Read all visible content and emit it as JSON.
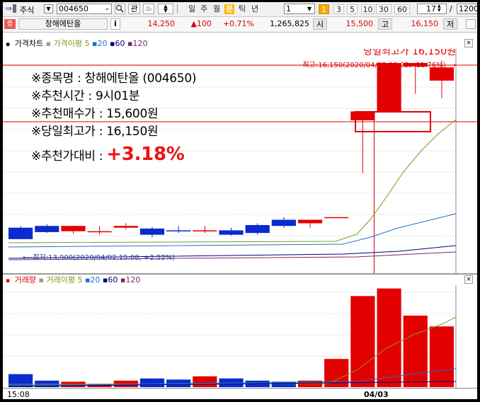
{
  "toolbar": {
    "market_label": "주식",
    "stock_code": "004650",
    "search_icon": "magnifier-icon",
    "interest_label": "관",
    "period_tabs": [
      {
        "label": "일",
        "active": false
      },
      {
        "label": "주",
        "active": false
      },
      {
        "label": "월",
        "active": false
      },
      {
        "label": "분",
        "active": true
      },
      {
        "label": "틱",
        "active": false
      },
      {
        "label": "년",
        "active": false
      }
    ],
    "unit_value": "1",
    "interval_buttons": [
      {
        "label": "1",
        "active": true
      },
      {
        "label": "3",
        "active": false
      },
      {
        "label": "5",
        "active": false
      },
      {
        "label": "10",
        "active": false
      },
      {
        "label": "30",
        "active": false
      },
      {
        "label": "60",
        "active": false
      }
    ],
    "zoom_value": "17",
    "divider": "/",
    "total_value": "1200"
  },
  "quote_bar": {
    "badge": "증",
    "stock_name": "창해에탄올",
    "info_label": "i",
    "price": "14,250",
    "change": "▲100",
    "change_pct": "+0.71%",
    "volume": "1,265,825",
    "open_label": "시",
    "open_value": "15,500",
    "high_label": "고",
    "high_value": "16,150",
    "low_label": "저"
  },
  "price_panel": {
    "legend_title": "가격차트",
    "legend_ma_label": "가격이평",
    "legend_periods": [
      "5",
      "20",
      "60",
      "120"
    ],
    "legend_colors": [
      "#7a9a1a",
      "#1f6fd0",
      "#000080",
      "#7a2a6a"
    ],
    "annotation_title": "당일최고가 16,150원",
    "high_marker": "최고:16,150(2020/04/03,09:03, -11.76%)⟶",
    "low_marker": "⟵최저:13,900(2020/04/02,15:08, +2.52%)",
    "recommendation": {
      "name_line": "※종목명 : 창해에탄올 (004650)",
      "time_line": "※추천시간 : 9시01분",
      "buy_line": "※추천매수가 : 15,600원",
      "high_line": "※당일최고가 : 16,150원",
      "ratio_label": "※추천가대비 :",
      "ratio_value": "+3.18%"
    }
  },
  "volume_panel": {
    "legend_title": "거래량",
    "legend_ma_label": "거래이평",
    "legend_periods": [
      "5",
      "20",
      "60",
      "120"
    ]
  },
  "x_axis": {
    "labels": [
      "15:08",
      "04/03"
    ]
  },
  "chart_data": {
    "type": "candlestick",
    "candles": [
      {
        "open": 14280,
        "high": 14300,
        "low": 14150,
        "close": 14150,
        "volume": 60
      },
      {
        "open": 14300,
        "high": 14320,
        "low": 14220,
        "close": 14230,
        "volume": 30
      },
      {
        "open": 14240,
        "high": 14300,
        "low": 14210,
        "close": 14300,
        "volume": 25
      },
      {
        "open": 14240,
        "high": 14300,
        "low": 14200,
        "close": 14240,
        "volume": 15
      },
      {
        "open": 14280,
        "high": 14330,
        "low": 14260,
        "close": 14300,
        "volume": 30
      },
      {
        "open": 14270,
        "high": 14290,
        "low": 14170,
        "close": 14200,
        "volume": 40
      },
      {
        "open": 14250,
        "high": 14300,
        "low": 14220,
        "close": 14240,
        "volume": 35
      },
      {
        "open": 14250,
        "high": 14300,
        "low": 14220,
        "close": 14250,
        "volume": 50
      },
      {
        "open": 14250,
        "high": 14280,
        "low": 14190,
        "close": 14200,
        "volume": 40
      },
      {
        "open": 14310,
        "high": 14330,
        "low": 14200,
        "close": 14220,
        "volume": 30
      },
      {
        "open": 14370,
        "high": 14400,
        "low": 14280,
        "close": 14300,
        "volume": 25
      },
      {
        "open": 14330,
        "high": 14370,
        "low": 14280,
        "close": 14370,
        "volume": 30
      },
      {
        "open": 14400,
        "high": 14400,
        "low": 14390,
        "close": 14400,
        "volume": 130
      },
      {
        "open": 15500,
        "high": 15600,
        "low": 14900,
        "close": 15600,
        "volume": 420
      },
      {
        "open": 15600,
        "high": 16150,
        "low": 15600,
        "close": 16150,
        "volume": 455
      },
      {
        "open": 16110,
        "high": 16130,
        "low": 15800,
        "close": 16150,
        "volume": 330
      },
      {
        "open": 15950,
        "high": 16180,
        "low": 15750,
        "close": 16100,
        "volume": 280
      }
    ],
    "ylim": [
      13900,
      16150
    ],
    "x_labels": [
      "15:08",
      "04/03"
    ],
    "recommended_buy_price": 15600,
    "day_high": 16150
  }
}
